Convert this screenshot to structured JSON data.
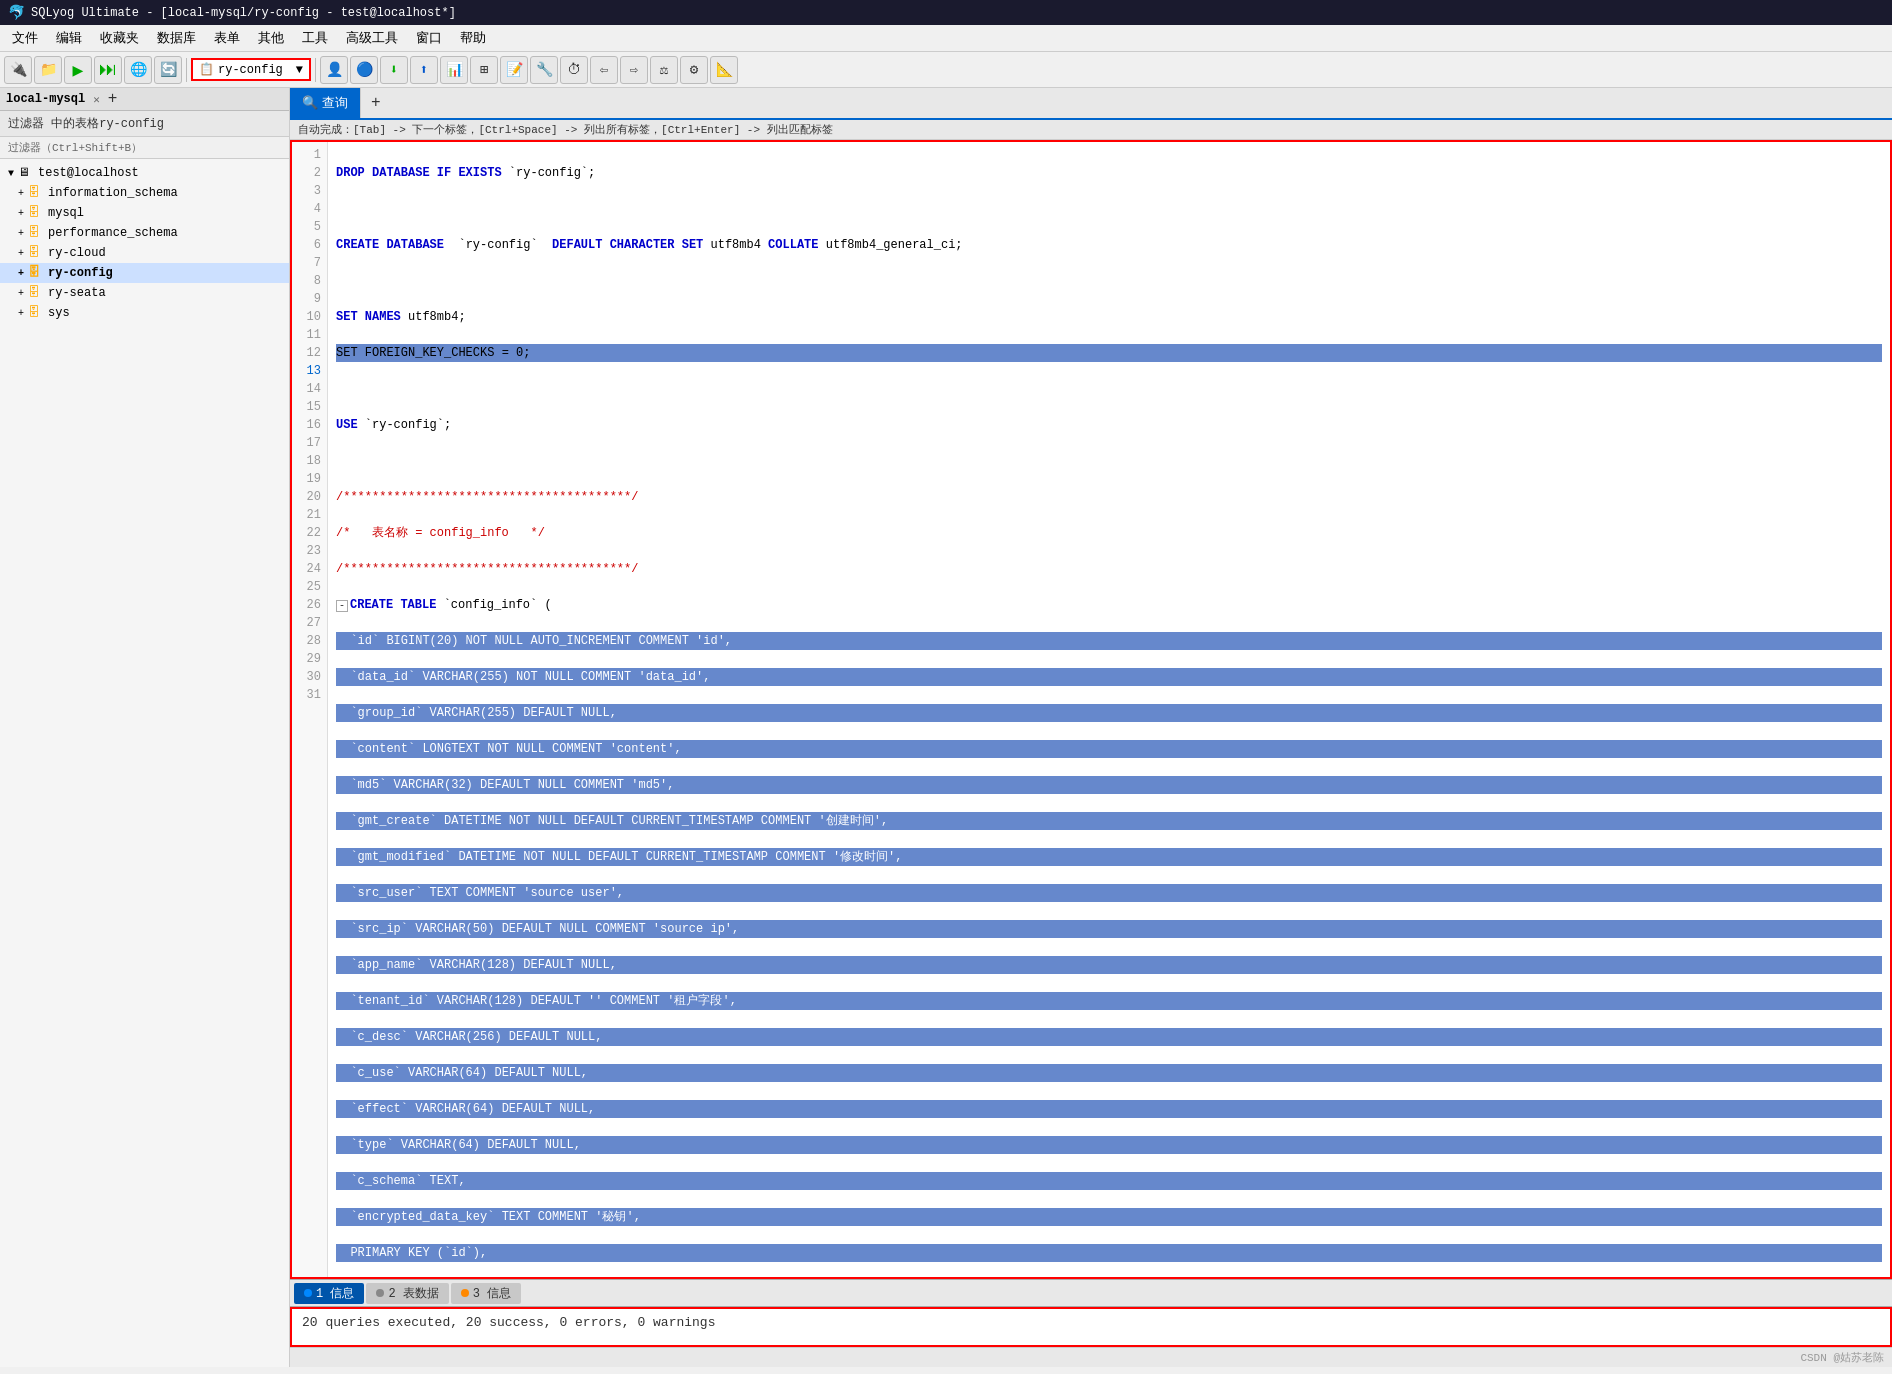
{
  "window": {
    "title": "SQLyog Ultimate - [local-mysql/ry-config - test@localhost*]",
    "icon": "sqlyog-icon"
  },
  "menubar": {
    "items": [
      "文件",
      "编辑",
      "收藏夹",
      "数据库",
      "表单",
      "其他",
      "工具",
      "高级工具",
      "窗口",
      "帮助"
    ]
  },
  "toolbar": {
    "db_select": "ry-config",
    "db_select_placeholder": "ry-config"
  },
  "sidebar": {
    "filter_label": "过滤器 中的表格ry-config",
    "filter_placeholder": "过滤器（Ctrl+Shift+B）",
    "connection": "test@localhost",
    "databases": [
      {
        "name": "information_schema",
        "expanded": false
      },
      {
        "name": "mysql",
        "expanded": false
      },
      {
        "name": "performance_schema",
        "expanded": false
      },
      {
        "name": "ry-cloud",
        "expanded": false
      },
      {
        "name": "ry-config",
        "expanded": false,
        "bold": true
      },
      {
        "name": "ry-seata",
        "expanded": false
      },
      {
        "name": "sys",
        "expanded": false
      }
    ]
  },
  "editor": {
    "tab_label": "查询",
    "tab_add": "+",
    "autocomplete_hint": "自动完成：[Tab] -> 下一个标签，[Ctrl+Space] -> 列出所有标签，[Ctrl+Enter] -> 列出匹配标签",
    "lines": [
      {
        "num": 1,
        "content": "DROP DATABASE IF EXISTS `ry-config`;",
        "style": "kw"
      },
      {
        "num": 2,
        "content": "",
        "style": "plain"
      },
      {
        "num": 3,
        "content": "CREATE DATABASE  `ry-config`  DEFAULT CHARACTER SET utf8mb4 COLLATE utf8mb4_general_ci;",
        "style": "kw"
      },
      {
        "num": 4,
        "content": "",
        "style": "plain"
      },
      {
        "num": 5,
        "content": "SET NAMES utf8mb4;",
        "style": "kw"
      },
      {
        "num": 6,
        "content": "SET FOREIGN_KEY_CHECKS = 0;",
        "style": "kw-selected"
      },
      {
        "num": 7,
        "content": "",
        "style": "plain"
      },
      {
        "num": 8,
        "content": "USE `ry-config`;",
        "style": "kw"
      },
      {
        "num": 9,
        "content": "",
        "style": "plain"
      },
      {
        "num": 10,
        "content": "/****************************************/",
        "style": "comment"
      },
      {
        "num": 11,
        "content": "/*   表名称 = config_info   */",
        "style": "comment"
      },
      {
        "num": 12,
        "content": "/****************************************/",
        "style": "comment"
      },
      {
        "num": 13,
        "content": "CREATE TABLE `config_info` (",
        "style": "kw-fold"
      },
      {
        "num": 14,
        "content": "  `id` BIGINT(20) NOT NULL AUTO_INCREMENT COMMENT 'id',",
        "style": "selected"
      },
      {
        "num": 15,
        "content": "  `data_id` VARCHAR(255) NOT NULL COMMENT 'data_id',",
        "style": "selected"
      },
      {
        "num": 16,
        "content": "  `group_id` VARCHAR(255) DEFAULT NULL,",
        "style": "selected"
      },
      {
        "num": 17,
        "content": "  `content` LONGTEXT NOT NULL COMMENT 'content',",
        "style": "selected"
      },
      {
        "num": 18,
        "content": "  `md5` VARCHAR(32) DEFAULT NULL COMMENT 'md5',",
        "style": "selected"
      },
      {
        "num": 19,
        "content": "  `gmt_create` DATETIME NOT NULL DEFAULT CURRENT_TIMESTAMP COMMENT '创建时间',",
        "style": "selected"
      },
      {
        "num": 20,
        "content": "  `gmt_modified` DATETIME NOT NULL DEFAULT CURRENT_TIMESTAMP COMMENT '修改时间',",
        "style": "selected"
      },
      {
        "num": 21,
        "content": "  `src_user` TEXT COMMENT 'source user',",
        "style": "selected"
      },
      {
        "num": 22,
        "content": "  `src_ip` VARCHAR(50) DEFAULT NULL COMMENT 'source ip',",
        "style": "selected"
      },
      {
        "num": 23,
        "content": "  `app_name` VARCHAR(128) DEFAULT NULL,",
        "style": "selected"
      },
      {
        "num": 24,
        "content": "  `tenant_id` VARCHAR(128) DEFAULT '' COMMENT '租户字段',",
        "style": "selected"
      },
      {
        "num": 25,
        "content": "  `c_desc` VARCHAR(256) DEFAULT NULL,",
        "style": "selected"
      },
      {
        "num": 26,
        "content": "  `c_use` VARCHAR(64) DEFAULT NULL,",
        "style": "selected"
      },
      {
        "num": 27,
        "content": "  `effect` VARCHAR(64) DEFAULT NULL,",
        "style": "selected"
      },
      {
        "num": 28,
        "content": "  `type` VARCHAR(64) DEFAULT NULL,",
        "style": "selected"
      },
      {
        "num": 29,
        "content": "  `c_schema` TEXT,",
        "style": "selected"
      },
      {
        "num": 30,
        "content": "  `encrypted_data_key` TEXT COMMENT '秘钥',",
        "style": "selected"
      },
      {
        "num": 31,
        "content": "  PRIMARY KEY (`id`),",
        "style": "selected-partial"
      }
    ]
  },
  "result_tabs": [
    {
      "label": "1 信息",
      "active": true,
      "dot_color": "blue"
    },
    {
      "label": "2 表数据",
      "active": false,
      "dot_color": "gray"
    },
    {
      "label": "3 信息",
      "active": false,
      "dot_color": "orange"
    }
  ],
  "result": {
    "text": "20 queries executed, 20 success, 0 errors, 0 warnings"
  },
  "statusbar": {
    "watermark": "CSDN @姑苏老陈"
  }
}
